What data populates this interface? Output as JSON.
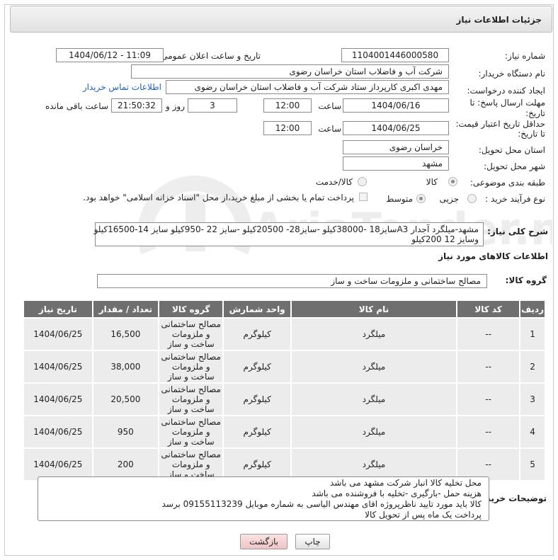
{
  "page_title": "جزئیات اطلاعات نیاز",
  "fields": {
    "need_number_label": "شماره نیاز:",
    "need_number": "1104001446000580",
    "announce_label": "تاریخ و ساعت اعلان عمومی:",
    "announce_value": "1404/06/12 - 11:09",
    "buyer_org_label": "نام دستگاه خریدار:",
    "buyer_org": "شرکت آب و فاضلاب استان خراسان رضوی",
    "creator_label": "ایجاد کننده درخواست:",
    "creator": "مهدی اکبری کارپرداز ستاد  شرکت آب و فاضلاب استان خراسان رضوی",
    "contact_link": "اطلاعات تماس خریدار",
    "deadline_label_1": "مهلت ارسال پاسخ: تا",
    "deadline_label_2": "تاریخ:",
    "deadline_date": "1404/06/16",
    "time_label": "ساعت",
    "deadline_time": "12:00",
    "days_value": "3",
    "days_label": "روز و",
    "remaining_time": "21:50:32",
    "remaining_label": "ساعت باقی مانده",
    "price_validity_label_1": "حداقل تاریخ اعتبار قیمت:",
    "price_validity_label_2": "تا تاریخ:",
    "price_validity_date": "1404/06/25",
    "price_validity_time": "12:00",
    "delivery_province_label": "استان محل تحویل:",
    "delivery_province": "خراسان رضوی",
    "delivery_city_label": "شهر محل تحویل:",
    "delivery_city": "مشهد",
    "category_label": "طبقه بندی موضوعی:",
    "category_options": [
      "کالا",
      "کالا/خدمت"
    ],
    "process_label": "نوع فرآیند خرید :",
    "process_options": [
      "جزیی",
      "متوسط"
    ],
    "payment_note": "پرداخت تمام یا بخشی از مبلغ خرید،از محل \"اسناد خزانه اسلامی\" خواهد بود.",
    "description_label": "شرح کلی نیاز:",
    "description_line1": "مشهد-میلگرد آجدار A3سایز18 -38000کیلو -سایز28- 20500کیلو -سایز 22 -950کیلو سایز 14-16500کیلو",
    "description_line2": "وسایز 12 200کیلو"
  },
  "goods_section_title": "اطلاعات کالاهای مورد نیاز",
  "goods_group_label": "گروه کالا:",
  "goods_group": "مصالح ساختمانی و ملزومات ساخت و ساز",
  "table": {
    "headers": [
      "ردیف",
      "کد کالا",
      "نام کالا",
      "واحد شمارش",
      "گروه کالا",
      "تعداد / مقدار",
      "تاریخ نیاز"
    ],
    "rows": [
      [
        "1",
        "--",
        "میلگرد",
        "کیلوگرم",
        "مصالح ساختمانی و ملزومات ساخت و ساز",
        "16,500",
        "1404/06/25"
      ],
      [
        "2",
        "--",
        "میلگرد",
        "کیلوگرم",
        "مصالح ساختمانی و ملزومات ساخت و ساز",
        "38,000",
        "1404/06/25"
      ],
      [
        "3",
        "--",
        "میلگرد",
        "کیلوگرم",
        "مصالح ساختمانی و ملزومات ساخت و ساز",
        "20,500",
        "1404/06/25"
      ],
      [
        "4",
        "--",
        "میلگرد",
        "کیلوگرم",
        "مصالح ساختمانی و ملزومات ساخت و ساز",
        "950",
        "1404/06/25"
      ],
      [
        "5",
        "--",
        "میلگرد",
        "کیلوگرم",
        "مصالح ساختمانی و ملزومات ساخت و ساز",
        "200",
        "1404/06/25"
      ]
    ]
  },
  "buyer_notes_label": "توضیحات خریدار:",
  "buyer_notes": [
    "محل تخلیه کالا انبار شرکت مشهد می باشد",
    "هزینه حمل -بارگیری -تخلیه با فروشنده می باشد",
    "کالا باید مورد تایید ناظرپروژه اقای مهندس الیاسی به شماره موبایل 09155113239 برسد",
    "پرداخت یک ماه پس از تحویل کالا"
  ],
  "buttons": {
    "print": "چاپ",
    "back": "بازگشت"
  },
  "watermark_text": "AriaTender.neT",
  "colors": {
    "header_bg": "#e6e6e6",
    "table_header": "#6f6f6f",
    "row_bg": "#ececec",
    "link": "#1f5fbf",
    "back_button_bg": "#f4cccc"
  }
}
